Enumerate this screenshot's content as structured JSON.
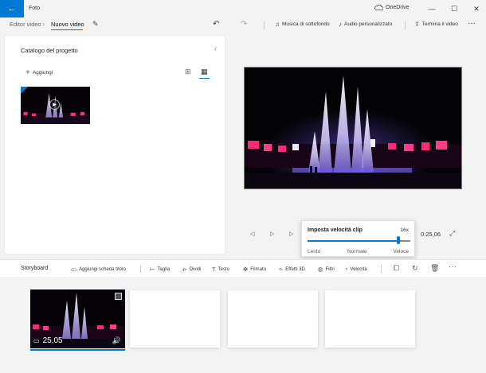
{
  "window": {
    "app_name": "Foto",
    "back_glyph": "←",
    "onedrive_label": "OneDrive",
    "minimize_glyph": "—",
    "maximize_glyph": "☐",
    "close_glyph": "✕"
  },
  "breadcrumb": {
    "root": "Editor video",
    "separator": "›",
    "current": "Nuovo video"
  },
  "toolbar": {
    "music_label": "Musica di sottofondo",
    "custom_audio_label": "Audio personalizzato",
    "finish_label": "Termina il video",
    "more_glyph": "···"
  },
  "catalog": {
    "title": "Catalogo del progetto",
    "add_label": "Aggiungi",
    "collapse_glyph": "‹"
  },
  "player": {
    "timecode": "0:25,06"
  },
  "speed_popup": {
    "title": "Imposta velocità clip",
    "value": "16x",
    "level": 0.88,
    "min_label": "Lento",
    "mid_label": "Normale",
    "max_label": "Veloce"
  },
  "storyboard": {
    "title": "Storyboard",
    "add_title_card": "Aggiungi scheda titolo",
    "trim": "Taglia",
    "split": "Dividi",
    "text": "Testo",
    "motion": "Filmato",
    "effects_3d": "Effetti 3D",
    "filters": "Filtri",
    "speed": "Velocità",
    "more_glyph": "···"
  },
  "clip": {
    "duration": "25,05"
  },
  "colors": {
    "accent": "#0078d4"
  }
}
